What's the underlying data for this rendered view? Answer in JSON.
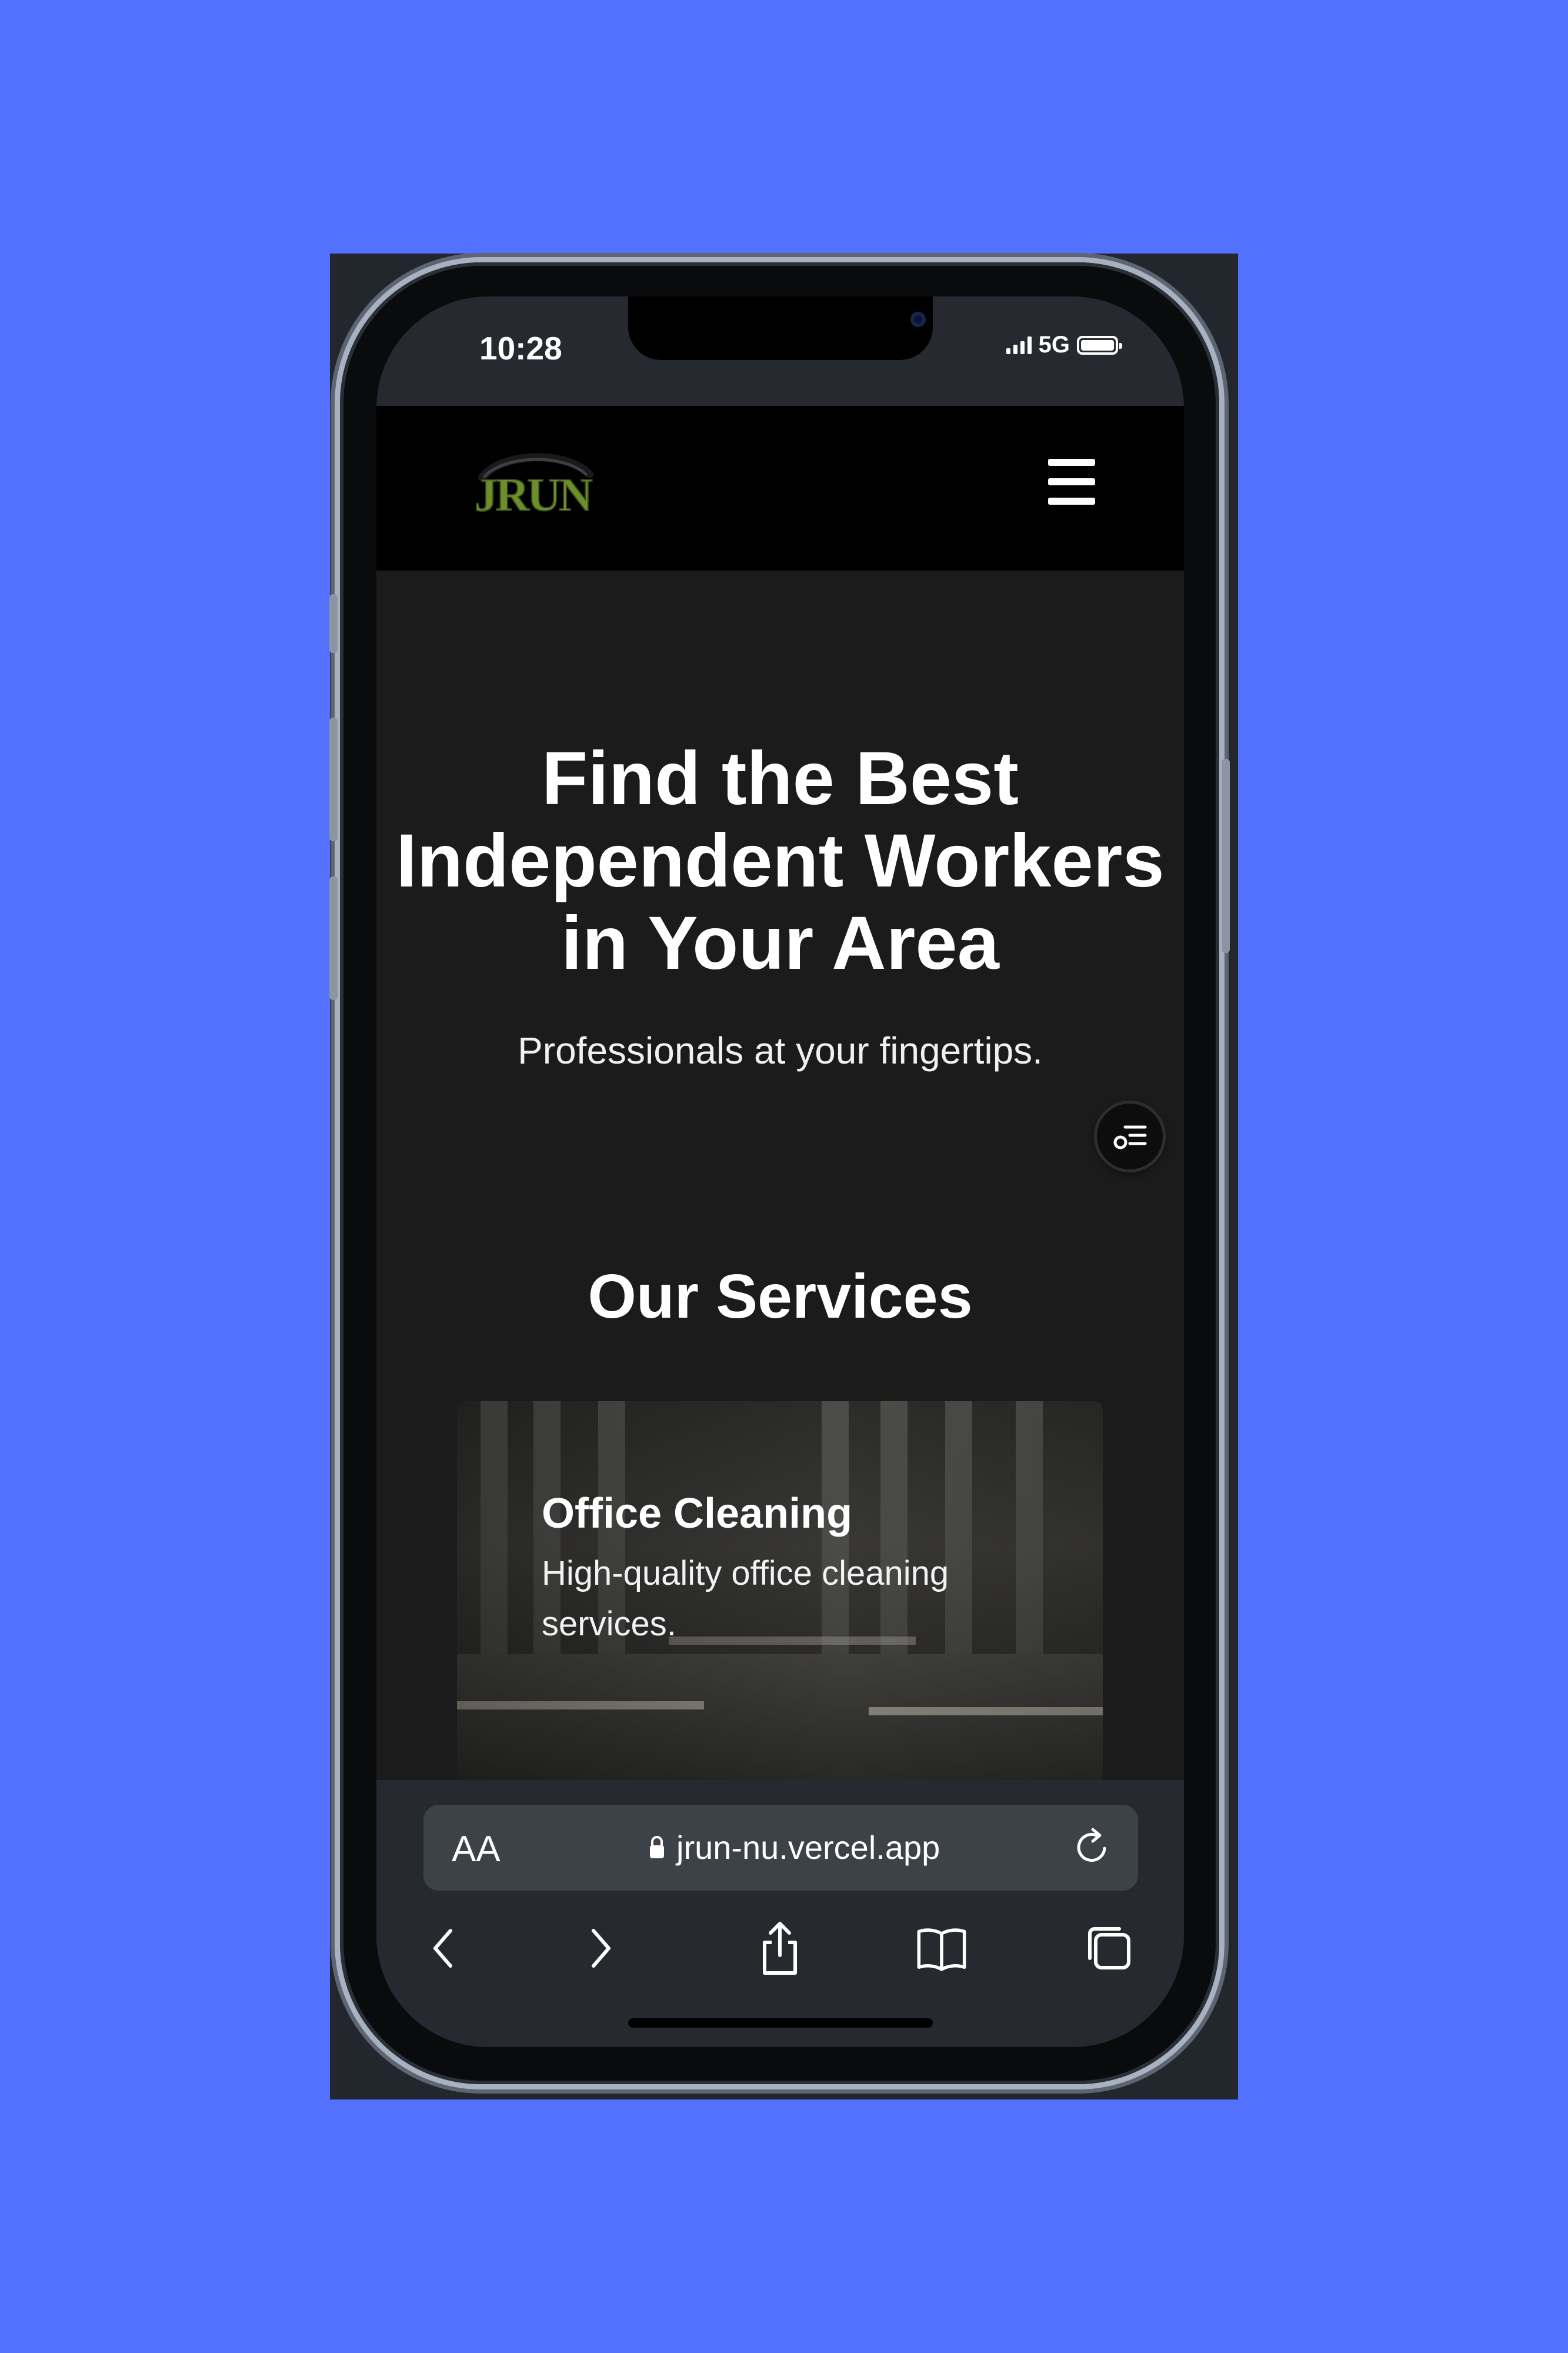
{
  "status_bar": {
    "time": "10:28",
    "network": "5G"
  },
  "site": {
    "logo_text": "JRUN",
    "logo_color": "#6d8f2a",
    "hero": {
      "title_line1": "Find the Best",
      "title_line2": "Independent Workers",
      "title_line3": "in Your Area",
      "subtitle": "Professionals at your fingertips."
    },
    "services": {
      "title": "Our Services",
      "cards": [
        {
          "title": "Office Cleaning",
          "description": "High-quality office cleaning services."
        }
      ]
    }
  },
  "browser": {
    "aa_label": "AA",
    "url": "jrun-nu.vercel.app",
    "nav_icons": [
      "back-icon",
      "forward-icon",
      "share-icon",
      "bookmarks-icon",
      "tabs-icon"
    ]
  },
  "colors": {
    "background": "#5271ff",
    "page_bg": "#1b1b1b",
    "header_bg": "#000000",
    "browser_chrome": "#262a30"
  }
}
